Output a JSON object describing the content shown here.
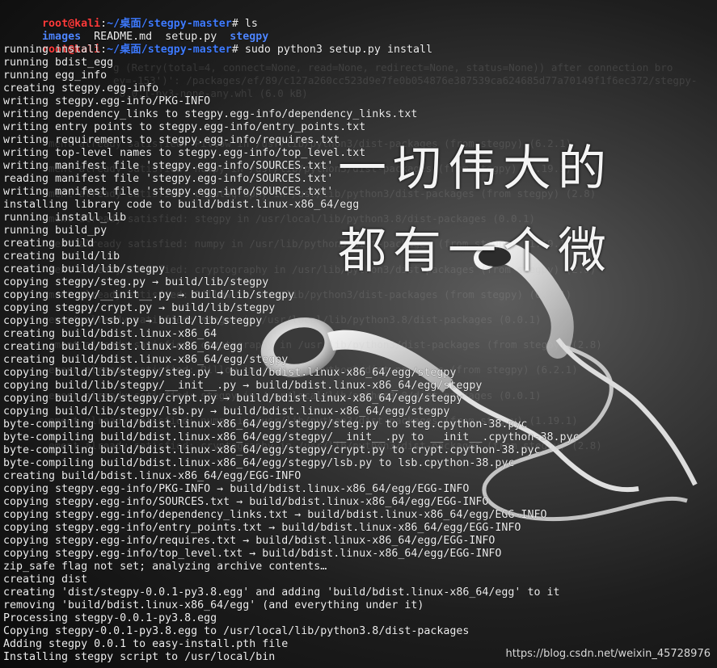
{
  "prompt": {
    "user": "root@kali",
    "colon": ":",
    "path": "~/桌面/stegpy-master",
    "symbol": "# "
  },
  "commands": [
    "ls",
    "sudo python3 setup.py install"
  ],
  "ls_output": {
    "dirs": [
      "images"
    ],
    "files": [
      "README.md",
      "setup.py"
    ],
    "exec": "stegpy"
  },
  "output_lines": [
    "running install",
    "running bdist_egg",
    "running egg_info",
    "creating stegpy.egg-info",
    "writing stegpy.egg-info/PKG-INFO",
    "writing dependency_links to stegpy.egg-info/dependency_links.txt",
    "writing entry points to stegpy.egg-info/entry_points.txt",
    "writing requirements to stegpy.egg-info/requires.txt",
    "writing top-level names to stegpy.egg-info/top_level.txt",
    "writing manifest file 'stegpy.egg-info/SOURCES.txt'",
    "reading manifest file 'stegpy.egg-info/SOURCES.txt'",
    "writing manifest file 'stegpy.egg-info/SOURCES.txt'",
    "installing library code to build/bdist.linux-x86_64/egg",
    "running install_lib",
    "running build_py",
    "creating build",
    "creating build/lib",
    "creating build/lib/stegpy",
    "copying stegpy/steg.py → build/lib/stegpy",
    "copying stegpy/__init__.py → build/lib/stegpy",
    "copying stegpy/crypt.py → build/lib/stegpy",
    "copying stegpy/lsb.py → build/lib/stegpy",
    "creating build/bdist.linux-x86_64",
    "creating build/bdist.linux-x86_64/egg",
    "creating build/bdist.linux-x86_64/egg/stegpy",
    "copying build/lib/stegpy/steg.py → build/bdist.linux-x86_64/egg/stegpy",
    "copying build/lib/stegpy/__init__.py → build/bdist.linux-x86_64/egg/stegpy",
    "copying build/lib/stegpy/crypt.py → build/bdist.linux-x86_64/egg/stegpy",
    "copying build/lib/stegpy/lsb.py → build/bdist.linux-x86_64/egg/stegpy",
    "byte-compiling build/bdist.linux-x86_64/egg/stegpy/steg.py to steg.cpython-38.pyc",
    "byte-compiling build/bdist.linux-x86_64/egg/stegpy/__init__.py to __init__.cpython-38.pyc",
    "byte-compiling build/bdist.linux-x86_64/egg/stegpy/crypt.py to crypt.cpython-38.pyc",
    "byte-compiling build/bdist.linux-x86_64/egg/stegpy/lsb.py to lsb.cpython-38.pyc",
    "creating build/bdist.linux-x86_64/egg/EGG-INFO",
    "copying stegpy.egg-info/PKG-INFO → build/bdist.linux-x86_64/egg/EGG-INFO",
    "copying stegpy.egg-info/SOURCES.txt → build/bdist.linux-x86_64/egg/EGG-INFO",
    "copying stegpy.egg-info/dependency_links.txt → build/bdist.linux-x86_64/egg/EGG-INFO",
    "copying stegpy.egg-info/entry_points.txt → build/bdist.linux-x86_64/egg/EGG-INFO",
    "copying stegpy.egg-info/requires.txt → build/bdist.linux-x86_64/egg/EGG-INFO",
    "copying stegpy.egg-info/top_level.txt → build/bdist.linux-x86_64/egg/EGG-INFO",
    "zip_safe flag not set; analyzing archive contents…",
    "creating dist",
    "creating 'dist/stegpy-0.0.1-py3.8.egg' and adding 'build/bdist.linux-x86_64/egg' to it",
    "removing 'build/bdist.linux-x86_64/egg' (and everything under it)",
    "Processing stegpy-0.0.1-py3.8.egg",
    "Copying stegpy-0.0.1-py3.8.egg to /usr/local/lib/python3.8/dist-packages",
    "Adding stegpy 0.0.1 to easy-install.pth file",
    "Installing stegpy script to /usr/local/bin"
  ],
  "ghost_lines": [
    "g (Retry(total=4, connect=None, read=None, redirect=None, status=None)) after connection bro",
    "ey=-153')': /packages/ef/89/c127a260cc523d9e7fe0b054876e387539ca624685d77a70149f1f6ec372/stegpy-",
    "-0.0.1-py3-none-any.whl (6.0 kB)",
    "ment already satisfied: Pillow in /usr/lib/python3/dist-packages (from stegpy) (6.2.1)",
    "ment already satisfied: numpy in /usr/lib/python3/dist-packages (from stegpy) (1.19.1)",
    "ment already satisfied: cryptography in /usr/lib/python3/dist-packages (from stegpy) (2.8)",
    "ment already satisfied: stegpy in /usr/local/lib/python3.8/dist-packages (0.0.1)",
    "ment already satisfied: numpy in /usr/lib/python3/dist-packages (from stegpy) (1.19.1)",
    "ment already satisfied: cryptography in /usr/lib/python3/dist-packages (from stegpy) (2.8)",
    "ment already satisfied: Pillow in /usr/lib/python3/dist-packages (from stegpy) (6.2.1)",
    "ement already satisfied: stegpy in /usr/local/lib/python3.8/dist-packages (0.0.1)",
    "ement already satisfied: cryptography in /usr/lib/python3/dist-packages (from stegpy) (2.8)",
    "ement already satisfied: Pillow in /usr/lib/python3/dist-packages (from stegpy) (6.2.1)",
    "ement already satisfied: stegpy in /usr/local/lib/python3.8/dist-packages (0.0.1)",
    "ement already satisfied: numpy in /usr/lib/python3/dist-packages (from stegpy) (1.19.1)",
    "ement already satisfied: cryptography in /usr/lib/python3/dist-packages (from stegpy) (2.8)"
  ],
  "overlay_text": {
    "line1": "一切伟大的",
    "line2": "都有一个微"
  },
  "watermark": "https://blog.csdn.net/weixin_45728976"
}
